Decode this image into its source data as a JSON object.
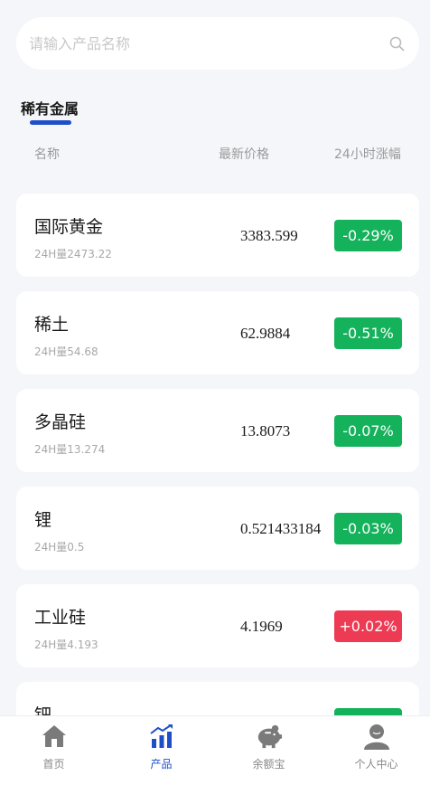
{
  "search": {
    "placeholder": "请输入产品名称",
    "value": ""
  },
  "section": {
    "title": "稀有金属"
  },
  "columns": {
    "name": "名称",
    "price": "最新价格",
    "change": "24小时涨幅"
  },
  "products": [
    {
      "name": "国际黄金",
      "volume": "24H量2473.22",
      "price": "3383.599",
      "change": "-0.29%",
      "trend": "down"
    },
    {
      "name": "稀土",
      "volume": "24H量54.68",
      "price": "62.9884",
      "change": "-0.51%",
      "trend": "down"
    },
    {
      "name": "多晶硅",
      "volume": "24H量13.274",
      "price": "13.8073",
      "change": "-0.07%",
      "trend": "down"
    },
    {
      "name": "锂",
      "volume": "24H量0.5",
      "price": "0.521433184",
      "change": "-0.03%",
      "trend": "down"
    },
    {
      "name": "工业硅",
      "volume": "24H量4.193",
      "price": "4.1969",
      "change": "+0.02%",
      "trend": "up"
    },
    {
      "name": "钯",
      "volume": "",
      "price": "",
      "change": "",
      "trend": "down"
    }
  ],
  "tabbar": {
    "items": [
      {
        "label": "首页",
        "icon": "home-icon",
        "active": false
      },
      {
        "label": "产品",
        "icon": "chart-icon",
        "active": true
      },
      {
        "label": "余额宝",
        "icon": "piggy-bank-icon",
        "active": false
      },
      {
        "label": "个人中心",
        "icon": "user-icon",
        "active": false
      }
    ]
  },
  "colors": {
    "accent": "#1e4fc8",
    "down": "#15b25c",
    "up": "#ee3b54"
  }
}
